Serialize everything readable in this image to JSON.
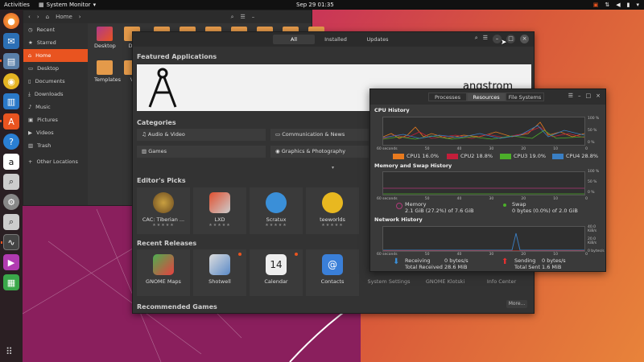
{
  "topbar": {
    "activities": "Activities",
    "app_name": "System Monitor",
    "clock": "Sep 29  01:35"
  },
  "files": {
    "path": "Home",
    "sidebar": [
      {
        "label": "Recent",
        "icon": "clock-icon"
      },
      {
        "label": "Starred",
        "icon": "star-icon"
      },
      {
        "label": "Home",
        "icon": "home-icon"
      },
      {
        "label": "Desktop",
        "icon": "desktop-icon"
      },
      {
        "label": "Documents",
        "icon": "document-icon"
      },
      {
        "label": "Downloads",
        "icon": "download-icon"
      },
      {
        "label": "Music",
        "icon": "music-icon"
      },
      {
        "label": "Pictures",
        "icon": "picture-icon"
      },
      {
        "label": "Videos",
        "icon": "video-icon"
      },
      {
        "label": "Trash",
        "icon": "trash-icon"
      },
      {
        "label": "Other Locations",
        "icon": "plus-icon"
      }
    ],
    "folders": [
      "Desktop",
      "Do",
      "Templates",
      "V"
    ]
  },
  "software": {
    "tabs": [
      "All",
      "Installed",
      "Updates"
    ],
    "featured_heading": "Featured Applications",
    "banner_title": "angstrom",
    "categories_heading": "Categories",
    "categories": [
      "Audio & Video",
      "Communication & News",
      "Games",
      "Graphics & Photography"
    ],
    "editors_heading": "Editor's Picks",
    "editors_picks": [
      "CAC: Tiberian ...",
      "LXD",
      "Scratux",
      "teeworlds"
    ],
    "recent_heading": "Recent Releases",
    "recent": [
      "GNOME Maps",
      "Shotwell",
      "Calendar",
      "Contacts",
      "System Settings",
      "GNOME Klotski",
      "Info Center"
    ],
    "games_heading": "Recommended Games",
    "more_label": "More..."
  },
  "sysmon": {
    "tabs": [
      "Processes",
      "Resources",
      "File Systems"
    ],
    "cpu_heading": "CPU History",
    "cpu_legend": [
      {
        "label": "CPU1  16.0%",
        "color": "#e87a1e"
      },
      {
        "label": "CPU2  18.8%",
        "color": "#c41e3a"
      },
      {
        "label": "CPU3  19.0%",
        "color": "#4caf2a"
      },
      {
        "label": "CPU4  28.8%",
        "color": "#3a7fc4"
      }
    ],
    "mem_heading": "Memory and Swap History",
    "memory_label": "Memory",
    "memory_value": "2.1 GiB (27.2%) of 7.6 GiB",
    "swap_label": "Swap",
    "swap_value": "0 bytes (0.0%) of 2.0 GiB",
    "net_heading": "Network History",
    "receiving_label": "Receiving",
    "receiving_value": "0 bytes/s",
    "total_received_label": "Total Received",
    "total_received_value": "28.6 MiB",
    "sending_label": "Sending",
    "sending_value": "0 bytes/s",
    "total_sent_label": "Total Sent",
    "total_sent_value": "1.6 MiB",
    "x_ticks": [
      "60 seconds",
      "50",
      "40",
      "30",
      "20",
      "10",
      "0"
    ],
    "pct_ticks": [
      "100 %",
      "50 %",
      "0 %"
    ],
    "net_ticks": [
      "40.0 KiB/s",
      "20.0 KiB/s",
      "0 bytes/s"
    ]
  }
}
